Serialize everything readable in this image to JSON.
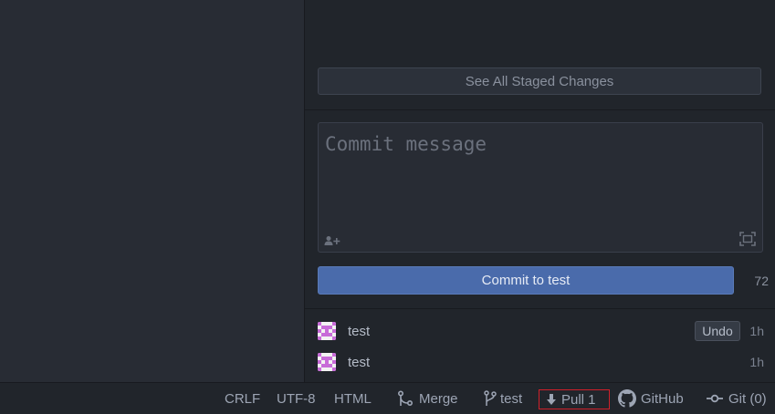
{
  "git_panel": {
    "see_staged_label": "See All Staged Changes",
    "commit_placeholder": "Commit message",
    "commit_button_label": "Commit to test",
    "remaining_chars": "72",
    "recent_commits": [
      {
        "message": "test",
        "time": "1h",
        "undo_label": "Undo"
      },
      {
        "message": "test",
        "time": "1h"
      }
    ]
  },
  "status_bar": {
    "line_ending": "CRLF",
    "encoding": "UTF-8",
    "grammar": "HTML",
    "merge_label": "Merge",
    "branch": "test",
    "pull_label": "Pull 1",
    "github_label": "GitHub",
    "git_label": "Git (0)"
  },
  "icons": {
    "coauthor": "person-add-icon",
    "expand": "expand-icon",
    "avatar": "identicon-avatar",
    "merge": "git-merge-icon",
    "branch": "git-branch-icon",
    "pull": "arrow-down-icon",
    "github": "github-mark-icon",
    "git": "git-commit-icon"
  },
  "colors": {
    "accent": "#4a6bab",
    "pull_highlight": "#d0202a",
    "avatar_pink": "#c86bd8"
  }
}
